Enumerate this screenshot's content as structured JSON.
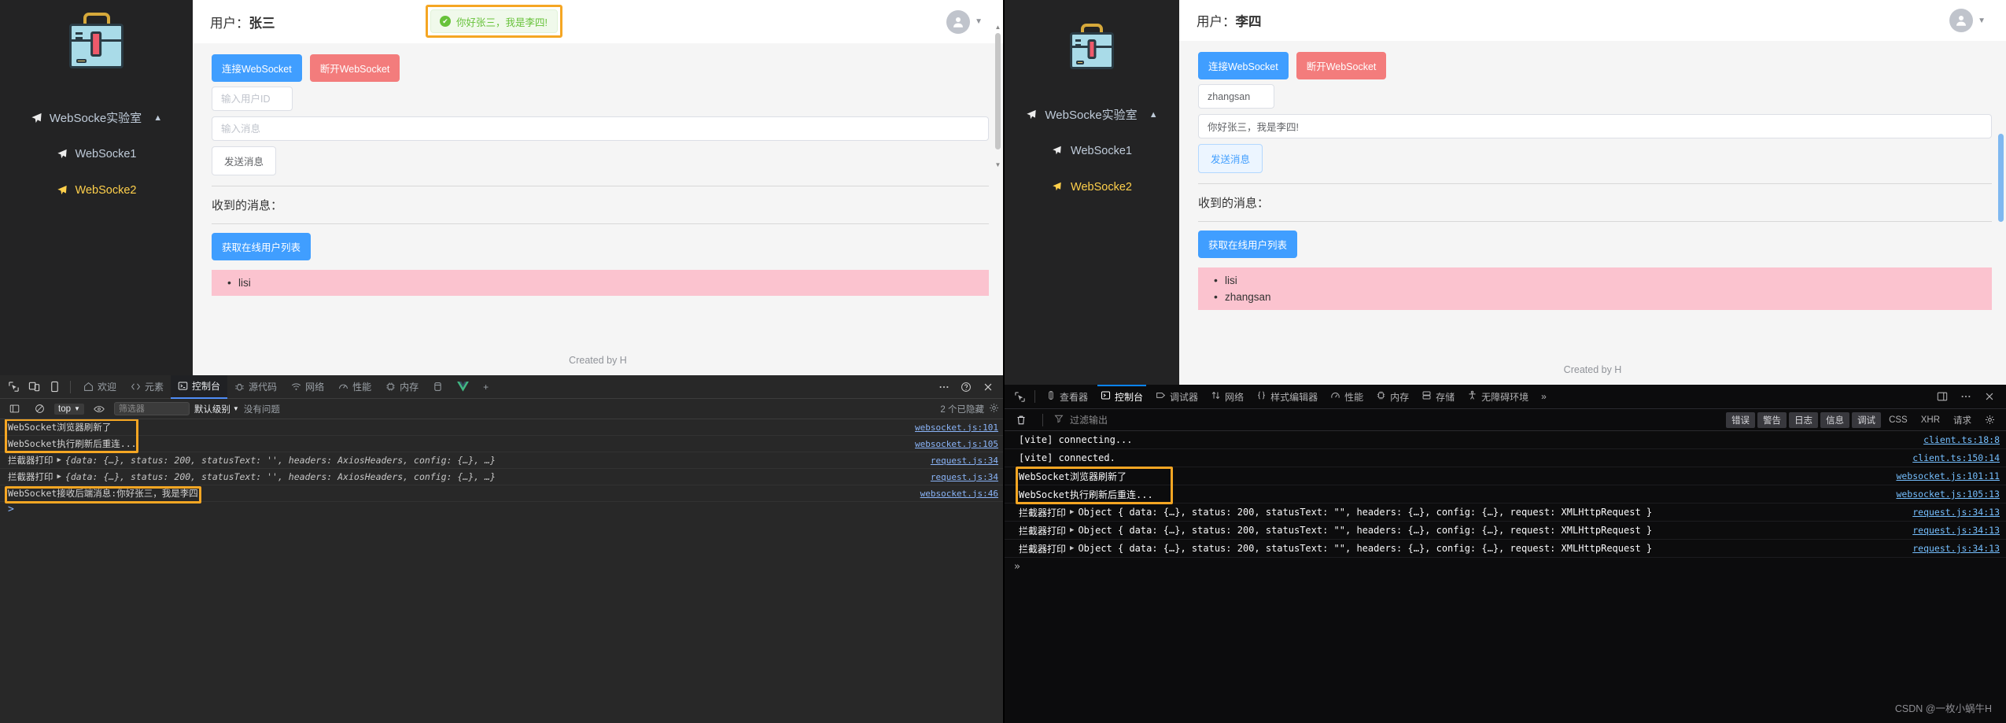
{
  "left": {
    "app": {
      "sidebar": {
        "logo_icon": "toolbox-icon",
        "group_label": "WebSocke实验室",
        "items": [
          {
            "label": "WebSocke1",
            "active": false
          },
          {
            "label": "WebSocke2",
            "active": true
          }
        ]
      },
      "header": {
        "user_prefix": "用户：",
        "user_name": "张三",
        "toast_text": "你好张三，我是李四!",
        "toast_color": "#67c23a",
        "toast_bg": "#f0f9eb",
        "highlight_color": "#f5a623"
      },
      "buttons": {
        "connect": "连接WebSocket",
        "disconnect": "断开WebSocket",
        "send": "发送消息",
        "get_users": "获取在线用户列表",
        "connect_color": "#409eff",
        "disconnect_color": "#f37c7c"
      },
      "inputs": {
        "user_id_placeholder": "输入用户ID",
        "user_id_value": "",
        "message_placeholder": "输入消息",
        "message_value": ""
      },
      "received_title": "收到的消息：",
      "online_users": [
        "lisi"
      ],
      "online_users_bg": "#fbc3cf",
      "footer": "Created by H"
    },
    "devtools": {
      "tabs": [
        {
          "label": "欢迎",
          "icon": "home-icon",
          "active": false
        },
        {
          "label": "元素",
          "icon": "code-brackets-icon",
          "active": false
        },
        {
          "label": "控制台",
          "icon": "console-icon",
          "active": true
        },
        {
          "label": "源代码",
          "icon": "bug-icon",
          "active": false
        },
        {
          "label": "网络",
          "icon": "wifi-icon",
          "active": false
        },
        {
          "label": "性能",
          "icon": "gauge-icon",
          "active": false
        },
        {
          "label": "内存",
          "icon": "chip-icon",
          "active": false
        },
        {
          "label": "应用",
          "icon": "database-icon",
          "active": false
        },
        {
          "label": "Vue",
          "icon": "vue-icon",
          "active": false
        }
      ],
      "tab_add": "+",
      "right_icons": [
        "more-vertical-icon",
        "help-icon",
        "close-icon"
      ],
      "left_icons": [
        "inspect-icon",
        "device-toolbar-icon",
        "mobile-icon"
      ],
      "filterbar": {
        "context": "top",
        "filter_placeholder": "筛选器",
        "filter_value": "",
        "level": "默认级别",
        "issues": "没有问题",
        "hidden_count": "2 个已隐藏",
        "settings_icon": "gear-icon",
        "eye_icon": "eye-icon",
        "clear_icon": "no-entry-icon",
        "sidebar_icon": "sidebar-icon"
      },
      "logs": [
        {
          "text": "WebSocket浏览器刷新了",
          "source": "websocket.js:101",
          "highlight": true
        },
        {
          "text": "WebSocket执行刷新后重连...",
          "source": "websocket.js:105",
          "highlight": true
        },
        {
          "prefix": "拦截器打印",
          "expandable": true,
          "obj": "{data: {…}, status: 200, statusText: '', headers: AxiosHeaders, config: {…}, …}",
          "source": "request.js:34",
          "highlight": false
        },
        {
          "prefix": "拦截器打印",
          "expandable": true,
          "obj": "{data: {…}, status: 200, statusText: '', headers: AxiosHeaders, config: {…}, …}",
          "source": "request.js:34",
          "highlight": false
        },
        {
          "text": "WebSocket接收后端消息:你好张三，我是李四!",
          "source": "websocket.js:46",
          "highlight": true
        }
      ],
      "prompt": ">"
    }
  },
  "right": {
    "app": {
      "sidebar": {
        "logo_icon": "toolbox-icon",
        "group_label": "WebSocke实验室",
        "items": [
          {
            "label": "WebSocke1",
            "active": false
          },
          {
            "label": "WebSocke2",
            "active": true
          }
        ]
      },
      "header": {
        "user_prefix": "用户：",
        "user_name": "李四"
      },
      "buttons": {
        "connect": "连接WebSocket",
        "disconnect": "断开WebSocket",
        "send": "发送消息",
        "get_users": "获取在线用户列表"
      },
      "inputs": {
        "user_id_placeholder": "输入用户ID",
        "user_id_value": "zhangsan",
        "message_placeholder": "输入消息",
        "message_value": "你好张三，我是李四!"
      },
      "received_title": "收到的消息：",
      "online_users": [
        "lisi",
        "zhangsan"
      ],
      "footer": "Created by H"
    },
    "devtools": {
      "tabs": [
        {
          "label": "查看器",
          "icon": "inspector-icon",
          "active": false
        },
        {
          "label": "控制台",
          "icon": "console-icon",
          "active": true
        },
        {
          "label": "调试器",
          "icon": "debugger-icon",
          "active": false
        },
        {
          "label": "网络",
          "icon": "network-arrows-icon",
          "active": false
        },
        {
          "label": "样式编辑器",
          "icon": "braces-icon",
          "active": false
        },
        {
          "label": "性能",
          "icon": "gauge-icon",
          "active": false
        },
        {
          "label": "内存",
          "icon": "chip-icon",
          "active": false
        },
        {
          "label": "存储",
          "icon": "storage-icon",
          "active": false
        },
        {
          "label": "无障碍环境",
          "icon": "accessibility-icon",
          "active": false
        }
      ],
      "overflow": "»",
      "right_icons": [
        "split-console-icon",
        "more-horizontal-icon",
        "close-icon"
      ],
      "picker_icon": "element-picker-icon",
      "filterbar": {
        "trash_icon": "trash-icon",
        "filter_icon": "funnel-icon",
        "filter_placeholder": "过滤输出",
        "filter_value": "",
        "pills": [
          {
            "label": "错误",
            "on": true
          },
          {
            "label": "警告",
            "on": true
          },
          {
            "label": "日志",
            "on": true
          },
          {
            "label": "信息",
            "on": true
          },
          {
            "label": "调试",
            "on": true
          }
        ],
        "plain_pills": [
          "CSS",
          "XHR",
          "请求"
        ],
        "settings_icon": "gear-icon"
      },
      "logs": [
        {
          "text": "[vite] connecting...",
          "source": "client.ts:18:8",
          "highlight": false
        },
        {
          "text": "[vite] connected.",
          "source": "client.ts:150:14",
          "highlight": false
        },
        {
          "text": "WebSocket浏览器刷新了",
          "source": "websocket.js:101:11",
          "highlight": true
        },
        {
          "text": "WebSocket执行刷新后重连...",
          "source": "websocket.js:105:13",
          "highlight": true
        },
        {
          "prefix": "拦截器打印",
          "expandable": true,
          "obj": "Object { data: {…}, status: 200, statusText: \"\", headers: {…}, config: {…}, request: XMLHttpRequest }",
          "source": "request.js:34:13",
          "highlight": false
        },
        {
          "prefix": "拦截器打印",
          "expandable": true,
          "obj": "Object { data: {…}, status: 200, statusText: \"\", headers: {…}, config: {…}, request: XMLHttpRequest }",
          "source": "request.js:34:13",
          "highlight": false
        },
        {
          "prefix": "拦截器打印",
          "expandable": true,
          "obj": "Object { data: {…}, status: 200, statusText: \"\", headers: {…}, config: {…}, request: XMLHttpRequest }",
          "source": "request.js:34:13",
          "highlight": false
        }
      ],
      "prompt": "»"
    },
    "watermark": "CSDN @一枚小蜗牛H"
  }
}
